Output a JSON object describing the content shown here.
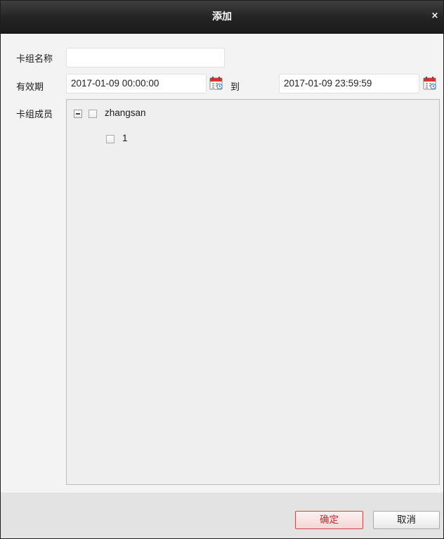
{
  "dialog": {
    "title": "添加",
    "close_symbol": "×"
  },
  "form": {
    "group_name_label": "卡组名称",
    "group_name_value": "",
    "validity_label": "有效期",
    "start_time": "2017-01-09 00:00:00",
    "to_label": "到",
    "end_time": "2017-01-09 23:59:59",
    "members_label": "卡组成员"
  },
  "tree": {
    "nodes": [
      {
        "label": "zhangsan",
        "expanded": true,
        "checked": false
      },
      {
        "label": "1",
        "checked": false
      }
    ]
  },
  "buttons": {
    "ok": "确定",
    "cancel": "取消"
  },
  "colors": {
    "title_bar": "#232323",
    "ok_button_text": "#c4262e",
    "ok_button_border": "#d14848",
    "calendar_accent": "#d9342b"
  },
  "icons": [
    "calendar-icon",
    "close-icon",
    "collapse-icon",
    "checkbox-icon"
  ]
}
